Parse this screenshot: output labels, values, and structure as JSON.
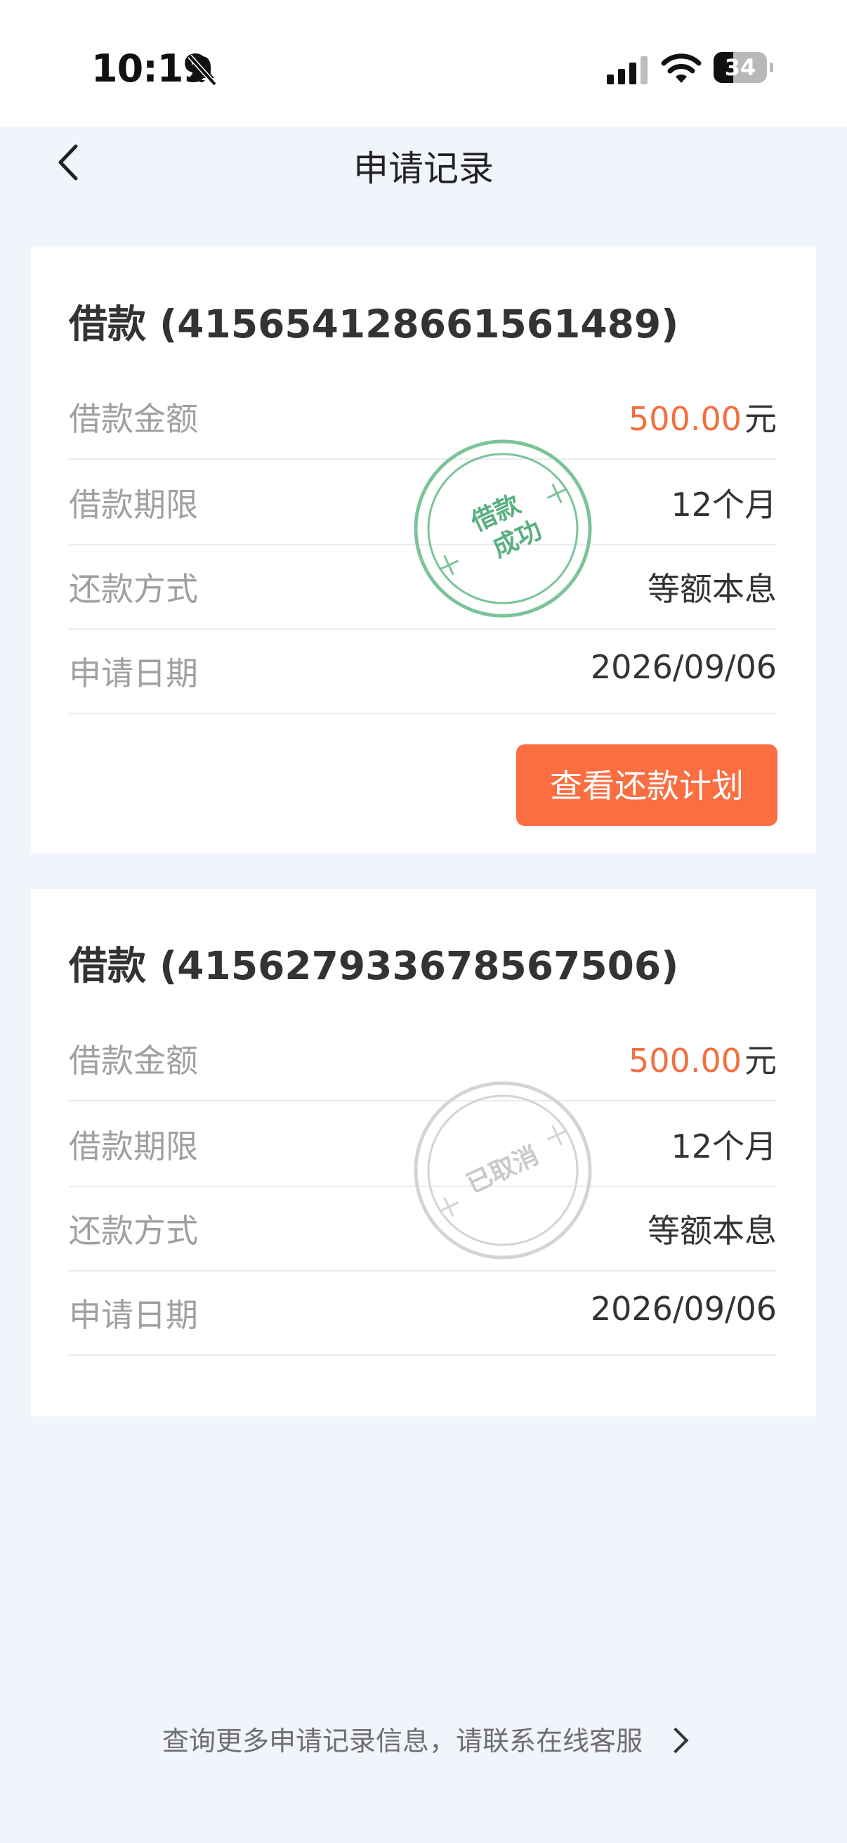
{
  "status_bar": {
    "time": "10:19",
    "battery_level": "34",
    "icons": [
      "bell-slash-icon",
      "signal-icon",
      "wifi-icon",
      "battery-icon"
    ]
  },
  "nav": {
    "title": "申请记录",
    "back_icon": "chevron-left-icon"
  },
  "records": [
    {
      "title": "借款 (415654128661561489)",
      "amount_label": "借款金额",
      "amount_value": "500.00",
      "amount_unit": "元",
      "term_label": "借款期限",
      "term_value": "12个月",
      "method_label": "还款方式",
      "method_value": "等额本息",
      "date_label": "申请日期",
      "date_value": "2026/09/06",
      "stamp_line1": "借款",
      "stamp_line2": "成功",
      "action_label": "查看还款计划"
    },
    {
      "title": "借款 (415627933678567506)",
      "amount_label": "借款金额",
      "amount_value": "500.00",
      "amount_unit": "元",
      "term_label": "借款期限",
      "term_value": "12个月",
      "method_label": "还款方式",
      "method_value": "等额本息",
      "date_label": "申请日期",
      "date_value": "2026/09/06",
      "stamp_line1": "已取消"
    }
  ],
  "footer": {
    "text": "查询更多申请记录信息，请联系在线客服"
  },
  "colors": {
    "accent": "#FB6E42",
    "amount": "#F36F3F",
    "success_stamp": "#58B07E",
    "cancelled_stamp": "#C9C9C9",
    "page_bg": "#F1F4FB"
  }
}
